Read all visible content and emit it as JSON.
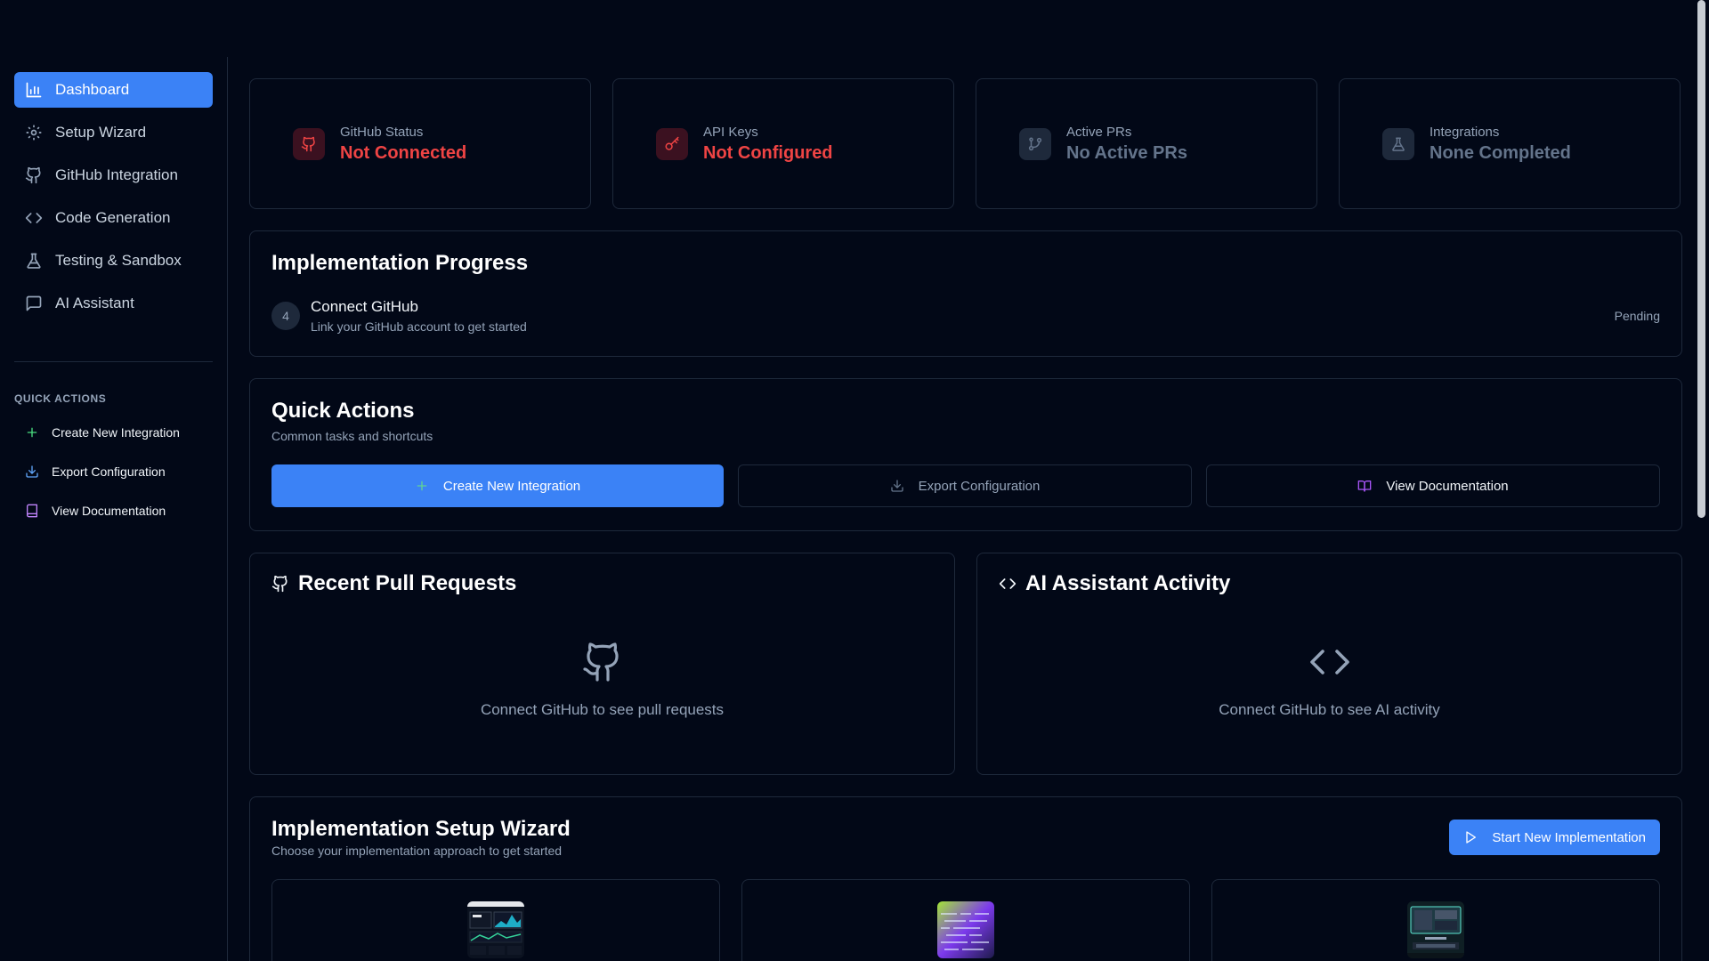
{
  "sidebar": {
    "nav": [
      {
        "label": "Dashboard",
        "icon": "bar-chart-icon",
        "active": true
      },
      {
        "label": "Setup Wizard",
        "icon": "gear-icon"
      },
      {
        "label": "GitHub Integration",
        "icon": "github-icon"
      },
      {
        "label": "Code Generation",
        "icon": "code-icon"
      },
      {
        "label": "Testing & Sandbox",
        "icon": "flask-icon"
      },
      {
        "label": "AI Assistant",
        "icon": "message-icon"
      }
    ],
    "quick_actions_label": "QUICK ACTIONS",
    "quick_actions": [
      {
        "label": "Create New Integration",
        "icon": "plus-icon"
      },
      {
        "label": "Export Configuration",
        "icon": "download-icon"
      },
      {
        "label": "View Documentation",
        "icon": "book-icon"
      }
    ]
  },
  "stats": [
    {
      "label": "GitHub Status",
      "value": "Not Connected",
      "icon": "github-icon",
      "tone": "red"
    },
    {
      "label": "API Keys",
      "value": "Not Configured",
      "icon": "key-icon",
      "tone": "red"
    },
    {
      "label": "Active PRs",
      "value": "No Active PRs",
      "icon": "git-branch-icon",
      "tone": "gray"
    },
    {
      "label": "Integrations",
      "value": "None Completed",
      "icon": "flask-icon",
      "tone": "gray"
    }
  ],
  "progress": {
    "title": "Implementation Progress",
    "step": {
      "number": "4",
      "title": "Connect GitHub",
      "description": "Link your GitHub account to get started",
      "status": "Pending"
    }
  },
  "quick_actions": {
    "title": "Quick Actions",
    "subtitle": "Common tasks and shortcuts",
    "buttons": [
      {
        "label": "Create New Integration",
        "icon": "plus-icon"
      },
      {
        "label": "Export Configuration",
        "icon": "download-icon"
      },
      {
        "label": "View Documentation",
        "icon": "book-icon"
      }
    ]
  },
  "pull_requests": {
    "title": "Recent Pull Requests",
    "empty_message": "Connect GitHub to see pull requests"
  },
  "ai_activity": {
    "title": "AI Assistant Activity",
    "empty_message": "Connect GitHub to see AI activity"
  },
  "wizard": {
    "title": "Implementation Setup Wizard",
    "subtitle": "Choose your implementation approach to get started",
    "start_label": "Start New Implementation"
  },
  "colors": {
    "accent": "#3b82f6",
    "danger": "#ef4444",
    "background": "#020817",
    "border": "#1e293b"
  }
}
